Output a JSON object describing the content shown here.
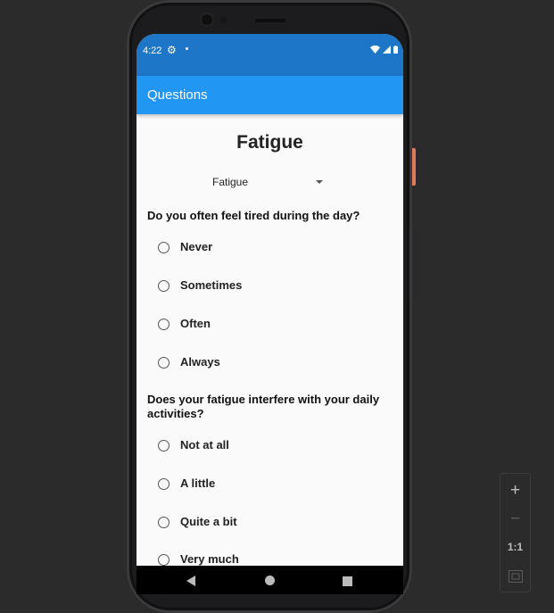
{
  "status_bar": {
    "time": "4:22",
    "settings_icon": "gear-icon",
    "wifi_icon": "wifi-icon",
    "signal_icon": "signal-icon",
    "battery_icon": "battery-icon"
  },
  "app_bar": {
    "title": "Questions",
    "color": "#2196f3"
  },
  "page": {
    "title": "Fatigue",
    "dropdown": {
      "selected": "Fatigue"
    }
  },
  "questions": [
    {
      "text": "Do you often feel tired during the day?",
      "options": [
        "Never",
        "Sometimes",
        "Often",
        "Always"
      ]
    },
    {
      "text": "Does your fatigue interfere with your daily activities?",
      "options": [
        "Not at all",
        "A little",
        "Quite a bit",
        "Very much"
      ]
    }
  ],
  "nav_bar": {
    "back_icon": "back-triangle-icon",
    "home_icon": "home-circle-icon",
    "recents_icon": "recents-square-icon"
  },
  "zoom_controls": {
    "zoom_in": "+",
    "zoom_out": "−",
    "one_to_one": "1:1",
    "fit_icon": "fit-screen-icon"
  }
}
